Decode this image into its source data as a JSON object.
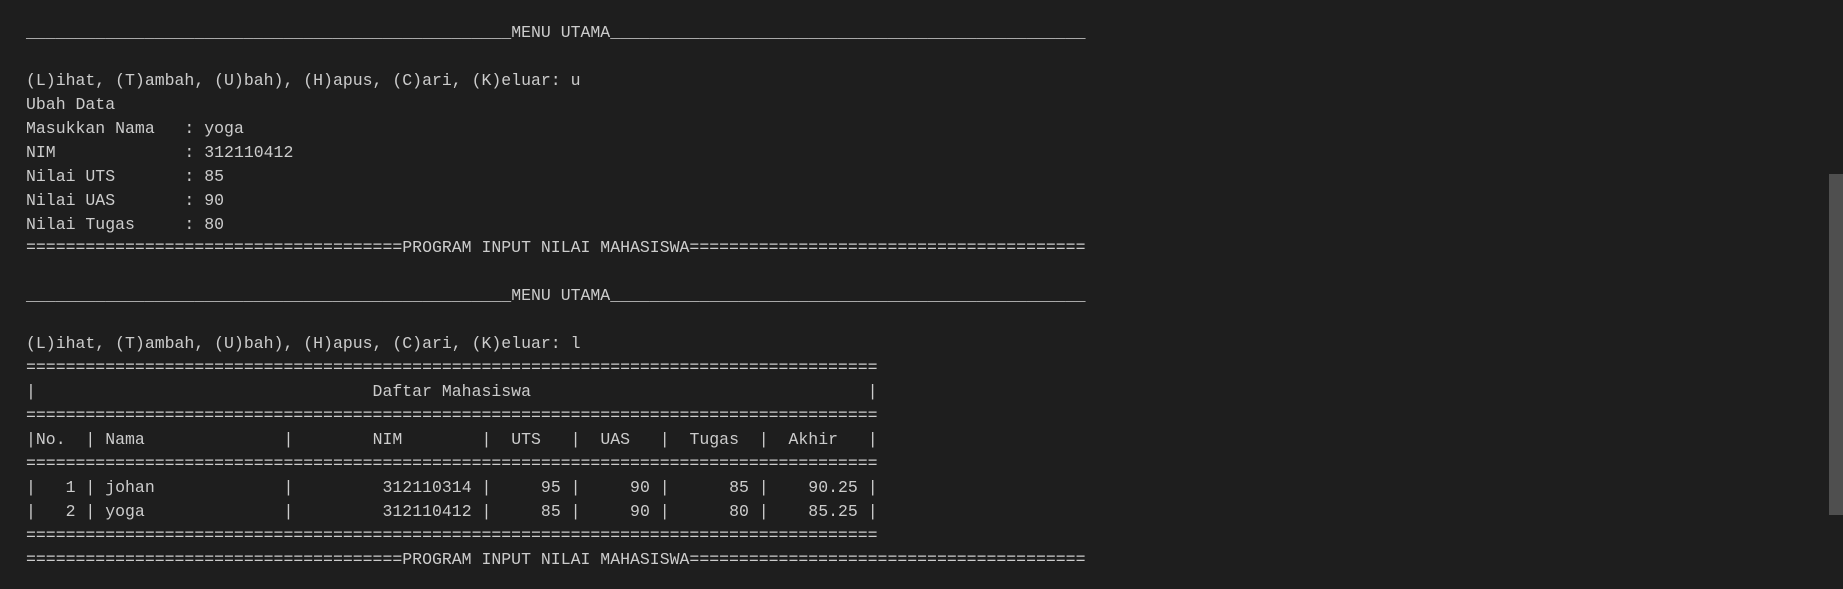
{
  "session1": {
    "menu_title": "MENU UTAMA",
    "prompt": "(L)ihat, (T)ambah, (U)bah), (H)apus, (C)ari, (K)eluar: ",
    "choice": "u",
    "heading": "Ubah Data",
    "fields": [
      {
        "label": "Masukkan Nama   : ",
        "value": "yoga"
      },
      {
        "label": "NIM             : ",
        "value": "312110412"
      },
      {
        "label": "Nilai UTS       : ",
        "value": "85"
      },
      {
        "label": "Nilai UAS       : ",
        "value": "90"
      },
      {
        "label": "Nilai Tugas     : ",
        "value": "80"
      }
    ],
    "footer_title": "PROGRAM INPUT NILAI MAHASISWA"
  },
  "session2": {
    "menu_title": "MENU UTAMA",
    "prompt": "(L)ihat, (T)ambah, (U)bah), (H)apus, (C)ari, (K)eluar: ",
    "choice": "l",
    "table": {
      "title": "Daftar Mahasiswa",
      "headers": [
        "No.",
        "Nama",
        "NIM",
        "UTS",
        "UAS",
        "Tugas",
        "Akhir"
      ],
      "rows": [
        [
          "1",
          "johan",
          "312110314",
          "95",
          "90",
          "85",
          "90.25"
        ],
        [
          "2",
          "yoga",
          "312110412",
          "85",
          "90",
          "80",
          "85.25"
        ]
      ]
    },
    "footer_title": "PROGRAM INPUT NILAI MAHASISWA"
  },
  "colors": {
    "background": "#1e1e1e",
    "text": "#cccccc",
    "scrollbar": "#4f4f4f"
  }
}
